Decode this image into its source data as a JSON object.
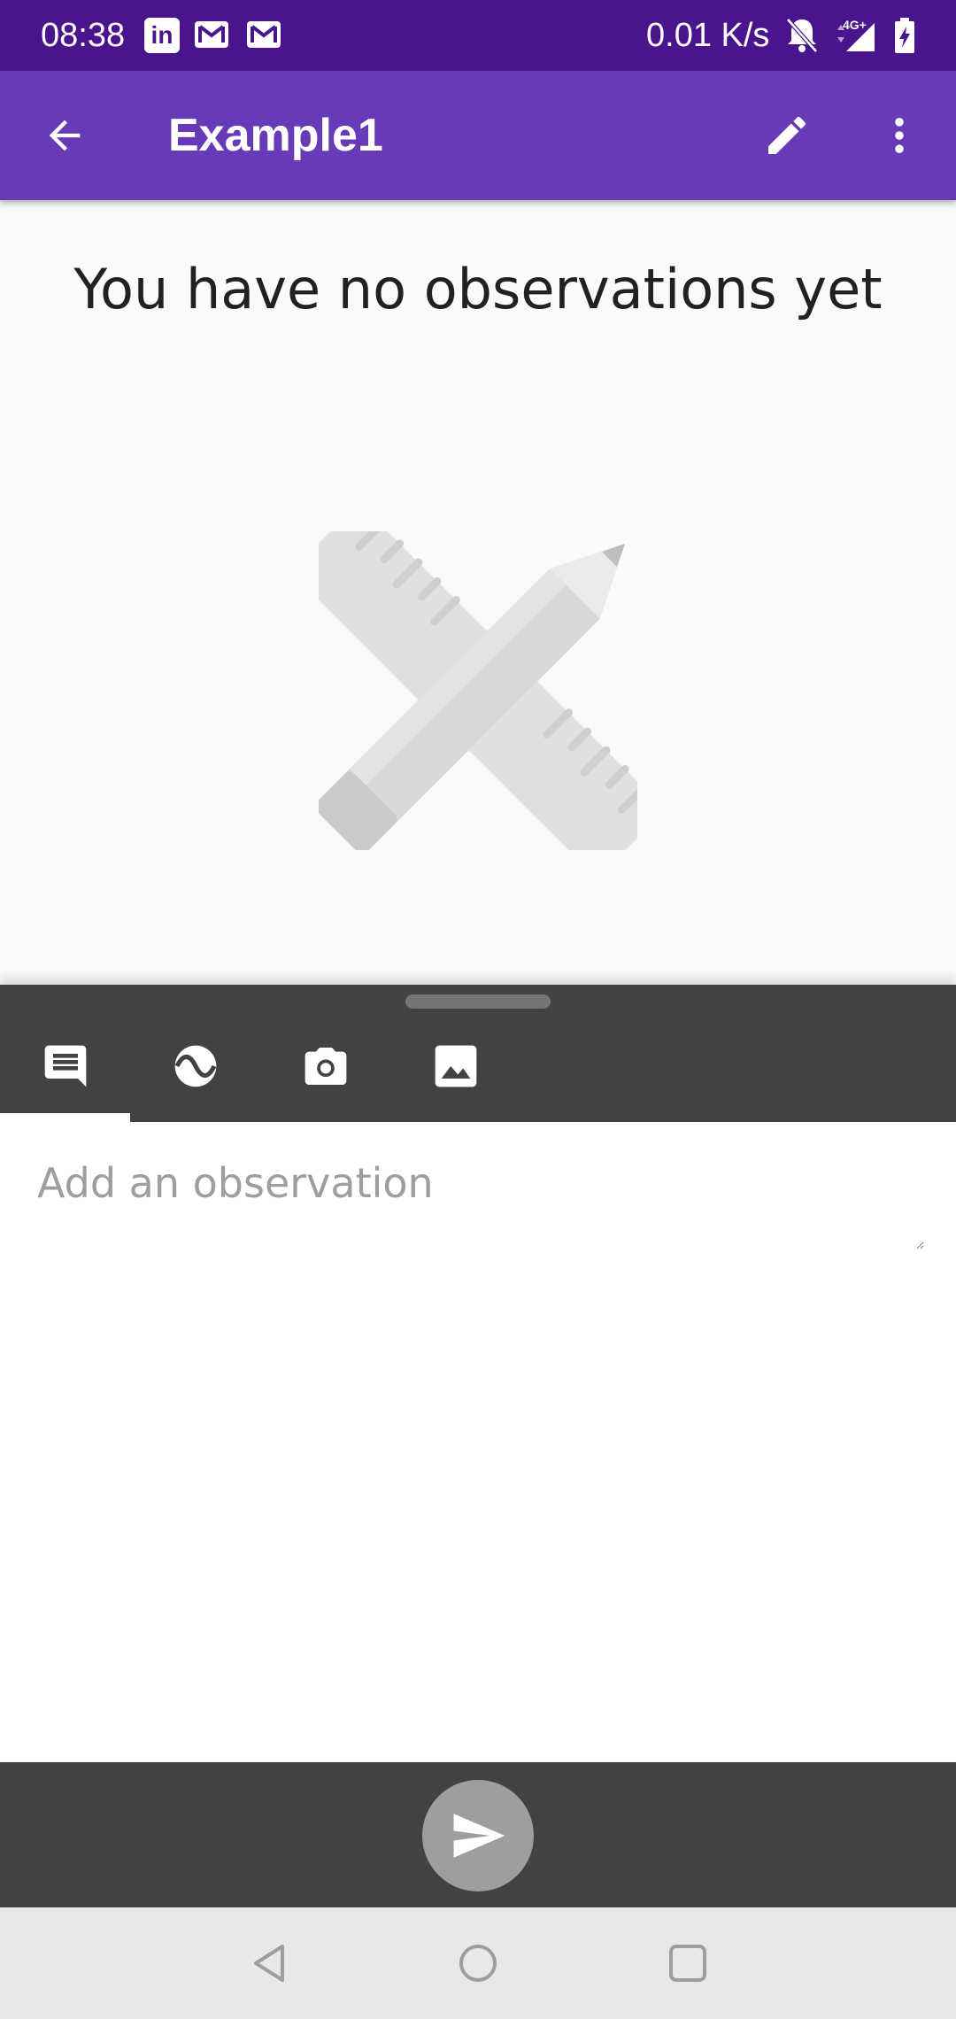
{
  "status_bar": {
    "time": "08:38",
    "notifications": [
      "linkedin-icon",
      "gmail-icon",
      "gmail-icon"
    ],
    "network_speed": "0.01 K/s",
    "network_type": "4G+"
  },
  "app_bar": {
    "title": "Example1",
    "background": "#673ab7"
  },
  "empty_state": {
    "message": "You have no observations yet"
  },
  "tabs": [
    {
      "name": "text-note",
      "icon": "comment-icon",
      "active": true
    },
    {
      "name": "sensor",
      "icon": "sensor-wave-icon",
      "active": false
    },
    {
      "name": "camera",
      "icon": "camera-icon",
      "active": false
    },
    {
      "name": "gallery",
      "icon": "image-icon",
      "active": false
    }
  ],
  "observation_input": {
    "placeholder": "Add an observation",
    "value": ""
  },
  "colors": {
    "status_bar": "#4a148c",
    "primary": "#673ab7",
    "panel": "#424242",
    "send_button": "#9e9e9e"
  }
}
